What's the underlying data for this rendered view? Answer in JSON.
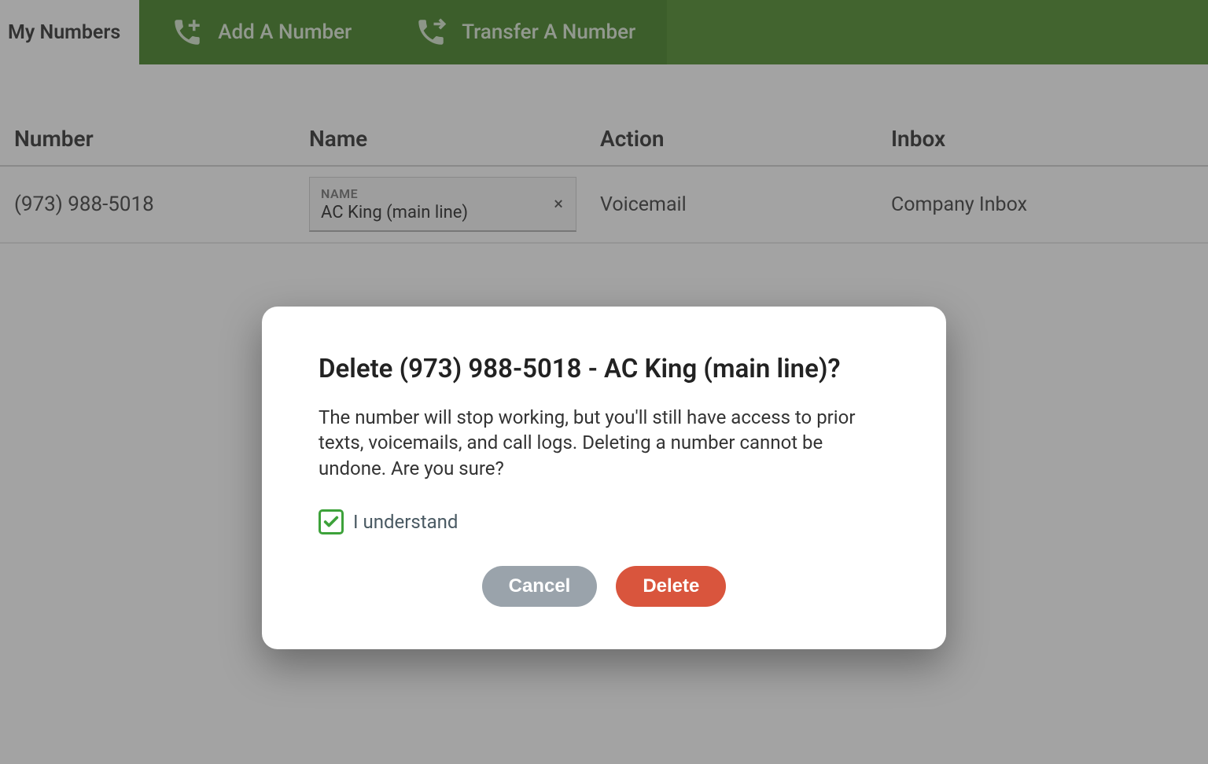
{
  "tabs": {
    "my_numbers": "My Numbers",
    "add_number": "Add A Number",
    "transfer_number": "Transfer A Number"
  },
  "table": {
    "headers": {
      "number": "Number",
      "name": "Name",
      "action": "Action",
      "inbox": "Inbox"
    },
    "rows": [
      {
        "number": "(973) 988-5018",
        "name_label": "NAME",
        "name_value": "AC King (main line)",
        "action": "Voicemail",
        "inbox": "Company Inbox"
      }
    ]
  },
  "dialog": {
    "title": "Delete (973) 988-5018 - AC King (main line)?",
    "body": "The number will stop working, but you'll still have access to prior texts, voicemails, and call logs. Deleting a number cannot be undone. Are you sure?",
    "understand_label": "I understand",
    "understand_checked": true,
    "cancel_label": "Cancel",
    "delete_label": "Delete"
  },
  "icons": {
    "clear": "×"
  }
}
